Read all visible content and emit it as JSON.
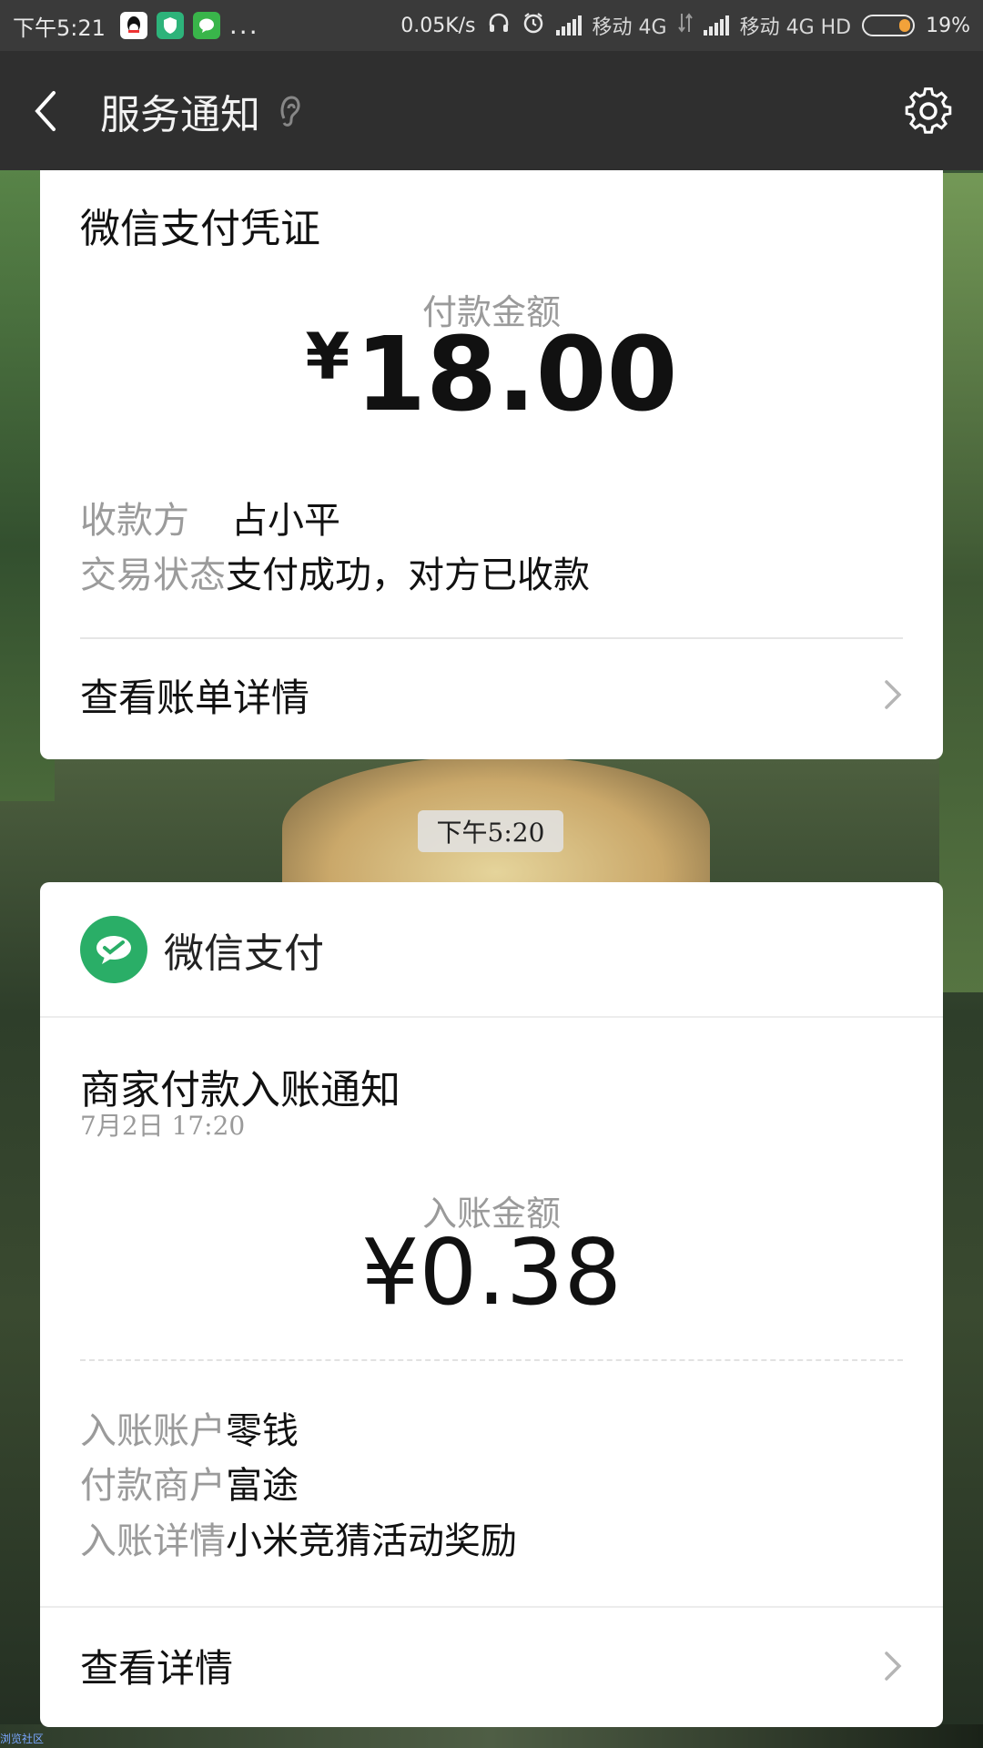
{
  "status_bar": {
    "time": "下午5:21",
    "network_speed": "0.05K/s",
    "carrier1": "移动 4G",
    "carrier2": "移动 4G HD",
    "battery": "19%",
    "battery_level": 0.19,
    "more": "..."
  },
  "app_bar": {
    "title": "服务通知",
    "icons": [
      "back-chevron-icon",
      "ear-icon",
      "gear-icon"
    ]
  },
  "card_payment_receipt": {
    "title": "微信支付凭证",
    "amount_label": "付款金额",
    "amount_currency": "¥",
    "amount_value": "18.00",
    "fields": [
      {
        "key": "收款方",
        "value": "占小平"
      },
      {
        "key": "交易状态",
        "value": "支付成功，对方已收款"
      }
    ],
    "link_label": "查看账单详情"
  },
  "time_chip": "下午5:20",
  "card_income_notice": {
    "brand": "微信支付",
    "title": "商家付款入账通知",
    "date": "7月2日  17:20",
    "amount_label": "入账金额",
    "amount": "¥0.38",
    "fields": [
      {
        "key": "入账账户",
        "value": "零钱"
      },
      {
        "key": "付款商户",
        "value": "富途"
      },
      {
        "key": "入账详情",
        "value": "小米竞猜活动奖励"
      }
    ],
    "link_label": "查看详情"
  },
  "watermark": "浏览社区",
  "colors": {
    "status_bar_bg": "#3a3a3a",
    "app_bar_bg": "#2f2f2f",
    "wechat_green": "#2aae67",
    "battery_accent": "#f2a23a"
  }
}
